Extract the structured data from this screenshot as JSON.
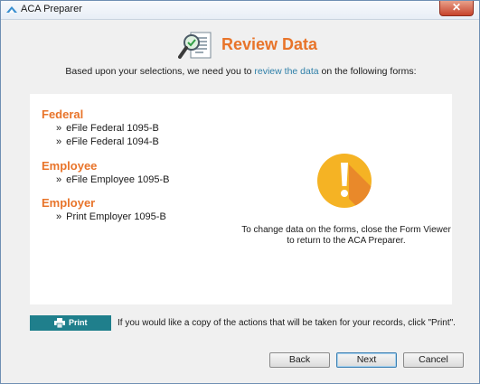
{
  "window": {
    "title": "ACA Preparer",
    "close_glyph": "✕"
  },
  "header": {
    "title": "Review Data",
    "icon": "magnifier-document-icon"
  },
  "intro": {
    "before": "Based upon your selections, we need you to ",
    "link": "review the data",
    "after": " on the following forms:"
  },
  "sections": [
    {
      "heading": "Federal",
      "items": [
        "eFile Federal 1095-B",
        "eFile Federal 1094-B"
      ]
    },
    {
      "heading": "Employee",
      "items": [
        "eFile Employee 1095-B"
      ]
    },
    {
      "heading": "Employer",
      "items": [
        "Print Employer 1095-B"
      ]
    }
  ],
  "bullet": "»",
  "note": {
    "line1": "To change data on the forms, close the Form Viewer",
    "line2": "to return to the ACA Preparer."
  },
  "print": {
    "label": "Print",
    "note": "If you would like a copy of the actions that will be taken for your records, click \"Print\"."
  },
  "buttons": {
    "back": "Back",
    "next": "Next",
    "cancel": "Cancel"
  },
  "colors": {
    "accent": "#e8742a",
    "link": "#2e7fa8",
    "print_button": "#1f7f8c",
    "warning": "#f5b324"
  }
}
